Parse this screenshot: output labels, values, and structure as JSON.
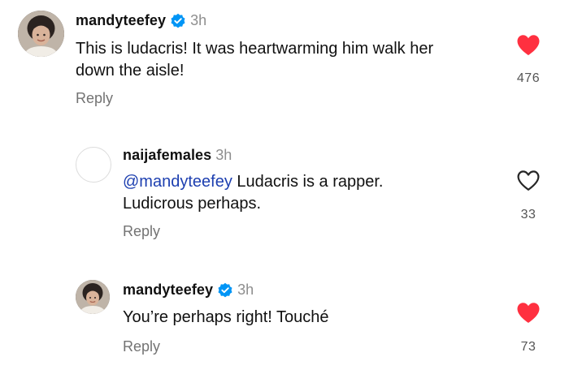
{
  "comments": [
    {
      "username": "mandyteefey",
      "verified": true,
      "time": "3h",
      "text": "This is ludacris! It was heartwarming him walk her\ndown the aisle!",
      "mention": "",
      "reply_label": "Reply",
      "liked": true,
      "like_count": "476"
    },
    {
      "username": "naijafemales",
      "verified": false,
      "time": "3h",
      "mention": "@mandyteefey",
      "text": " Ludacris is a rapper.\nLudicrous perhaps.",
      "reply_label": "Reply",
      "liked": false,
      "like_count": "33"
    },
    {
      "username": "mandyteefey",
      "verified": true,
      "time": "3h",
      "text": "You’re perhaps right! Touché",
      "mention": "",
      "reply_label": "Reply",
      "liked": true,
      "like_count": "73"
    }
  ],
  "colors": {
    "like_red": "#ff3040",
    "verified_blue": "#0095f6",
    "mention_blue": "#1d3fb0",
    "muted_text": "#737373"
  },
  "icons": {
    "avatar_photo": "avatar-icon",
    "verified": "verified-badge-icon",
    "liked": "heart-filled-icon",
    "unliked": "heart-outline-icon"
  }
}
